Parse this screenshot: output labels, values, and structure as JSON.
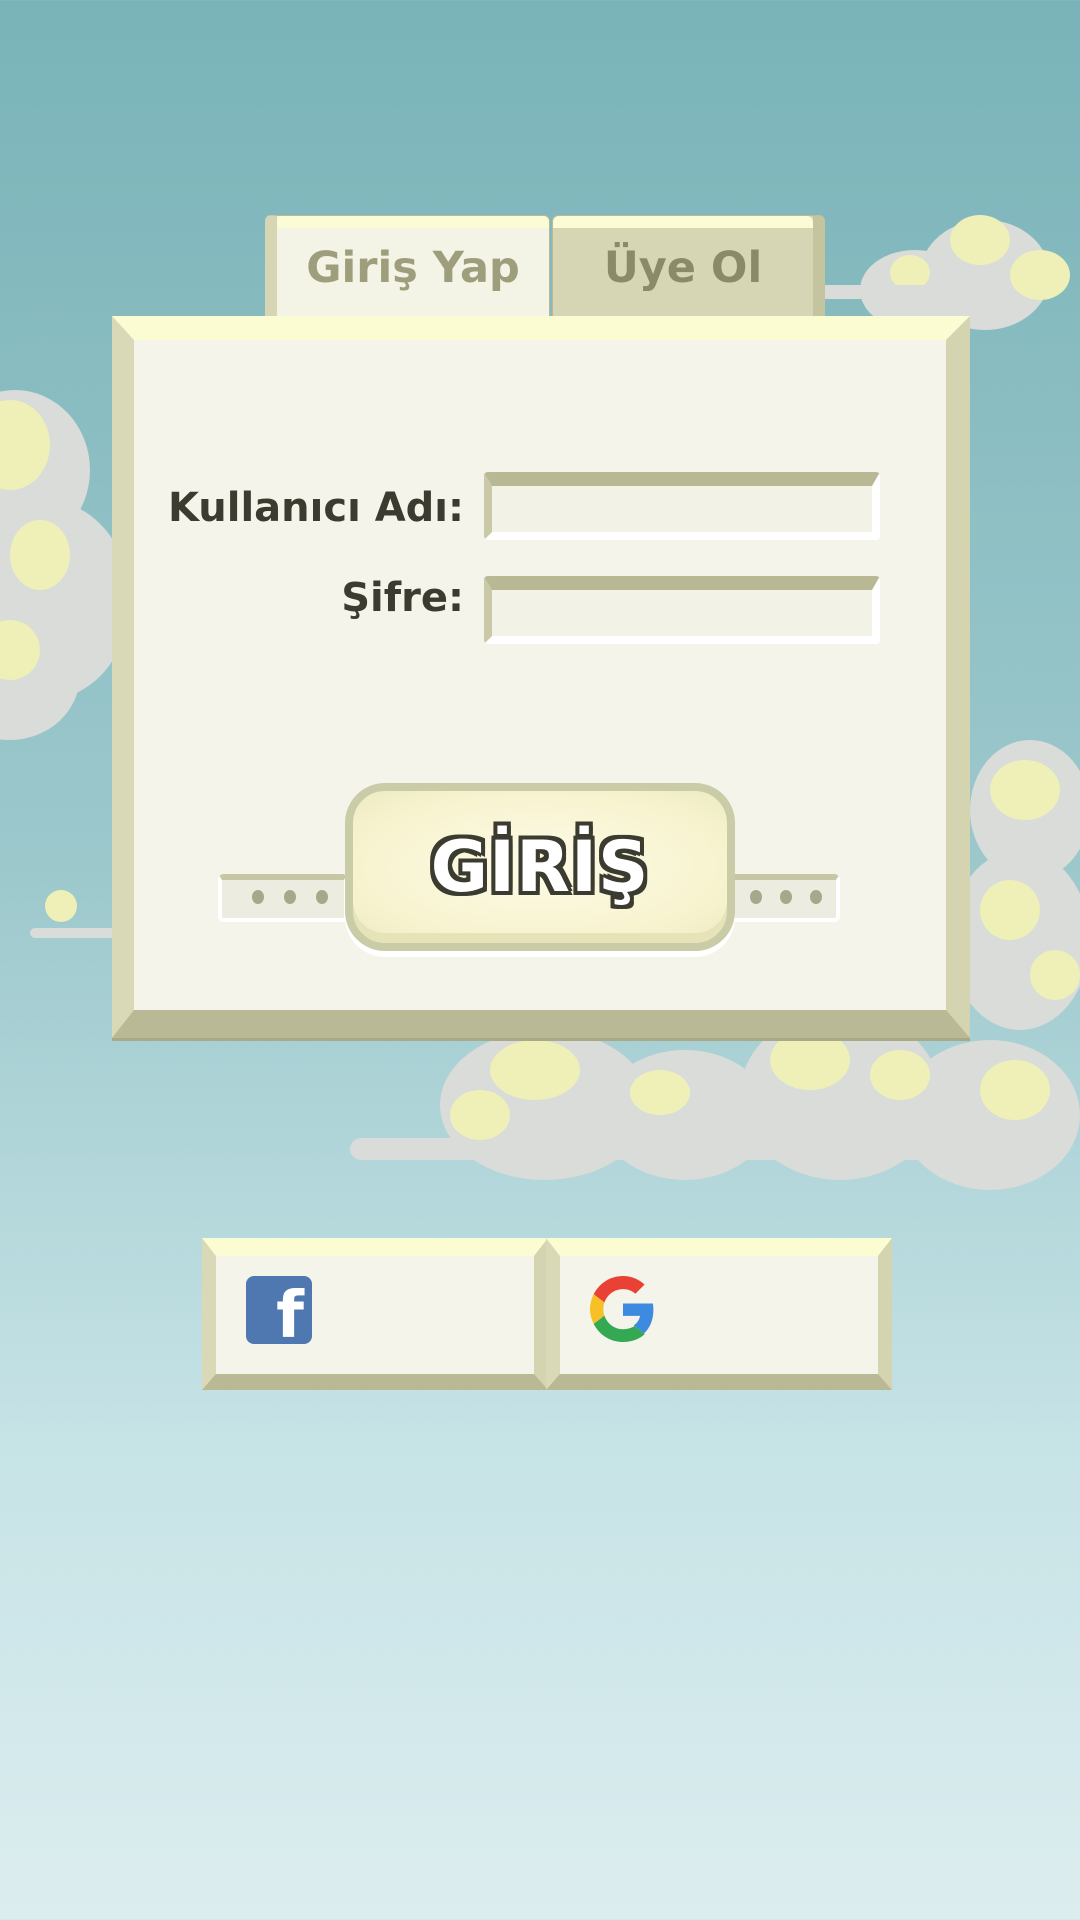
{
  "tabs": {
    "login_label": "Giriş Yap",
    "signup_label": "Üye Ol"
  },
  "form": {
    "username_label": "Kullanıcı Adı:",
    "username_value": "",
    "password_label": "Şifre:",
    "password_value": "",
    "submit_label": "GİRİŞ"
  },
  "social": {
    "facebook_icon": "facebook-icon",
    "facebook_glyph": "f",
    "google_icon": "google-icon"
  },
  "colors": {
    "sky_top": "#79b3b8",
    "sky_bottom": "#dcedef",
    "panel": "#f4f4ea",
    "facebook": "#4f77b0"
  }
}
